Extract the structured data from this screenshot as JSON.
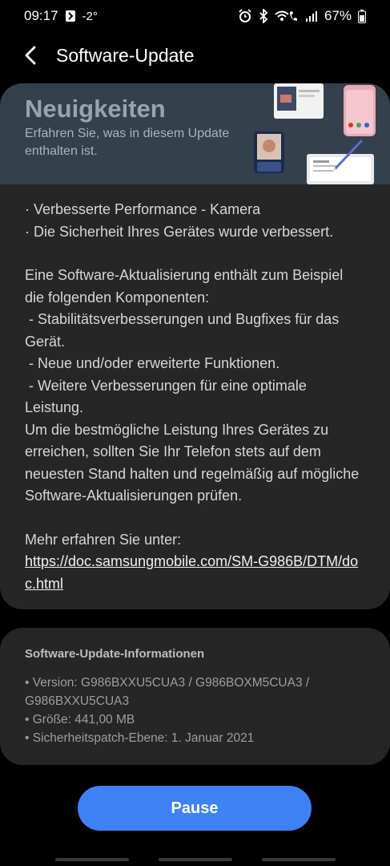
{
  "status_bar": {
    "time": "09:17",
    "temperature": "-2°",
    "battery": "67%",
    "icons": [
      "notification-icon",
      "alarm-icon",
      "bluetooth-icon",
      "wifi-icon",
      "wifi-calling-icon",
      "signal-icon",
      "battery-icon"
    ]
  },
  "header": {
    "title": "Software-Update",
    "back_icon": "back-arrow-icon"
  },
  "news_card": {
    "banner_title": "Neuigkeiten",
    "banner_subtitle": "Erfahren Sie, was in diesem Update enthalten ist.",
    "highlights": [
      "· Verbesserte Performance - Kamera",
      "· Die Sicherheit Ihres Gerätes wurde verbessert."
    ],
    "description": [
      "Eine Software-Aktualisierung enthält zum Beispiel die folgenden Komponenten:",
      " - Stabilitätsverbesserungen und Bugfixes für das Gerät.",
      " - Neue und/oder erweiterte Funktionen.",
      " - Weitere Verbesserungen für eine optimale Leistung.",
      "Um die bestmögliche Leistung Ihres Gerätes zu erreichen, sollten Sie Ihr Telefon stets auf dem neuesten Stand halten und regelmäßig auf mögliche Software-Aktualisierungen prüfen."
    ],
    "more_info_label": "Mehr erfahren Sie unter:",
    "more_info_link": "https://doc.samsungmobile.com/SM-G986B/DTM/doc.html"
  },
  "info_card": {
    "title": "Software-Update-Informationen",
    "version": "• Version: G986BXXU5CUA3 / G986BOXM5CUA3 / G986BXXU5CUA3",
    "size": "• Größe: 441,00 MB",
    "security_patch": "• Sicherheitspatch-Ebene: 1. Januar 2021"
  },
  "pause_button": {
    "label": "Pause",
    "color": "#3e82f7"
  }
}
